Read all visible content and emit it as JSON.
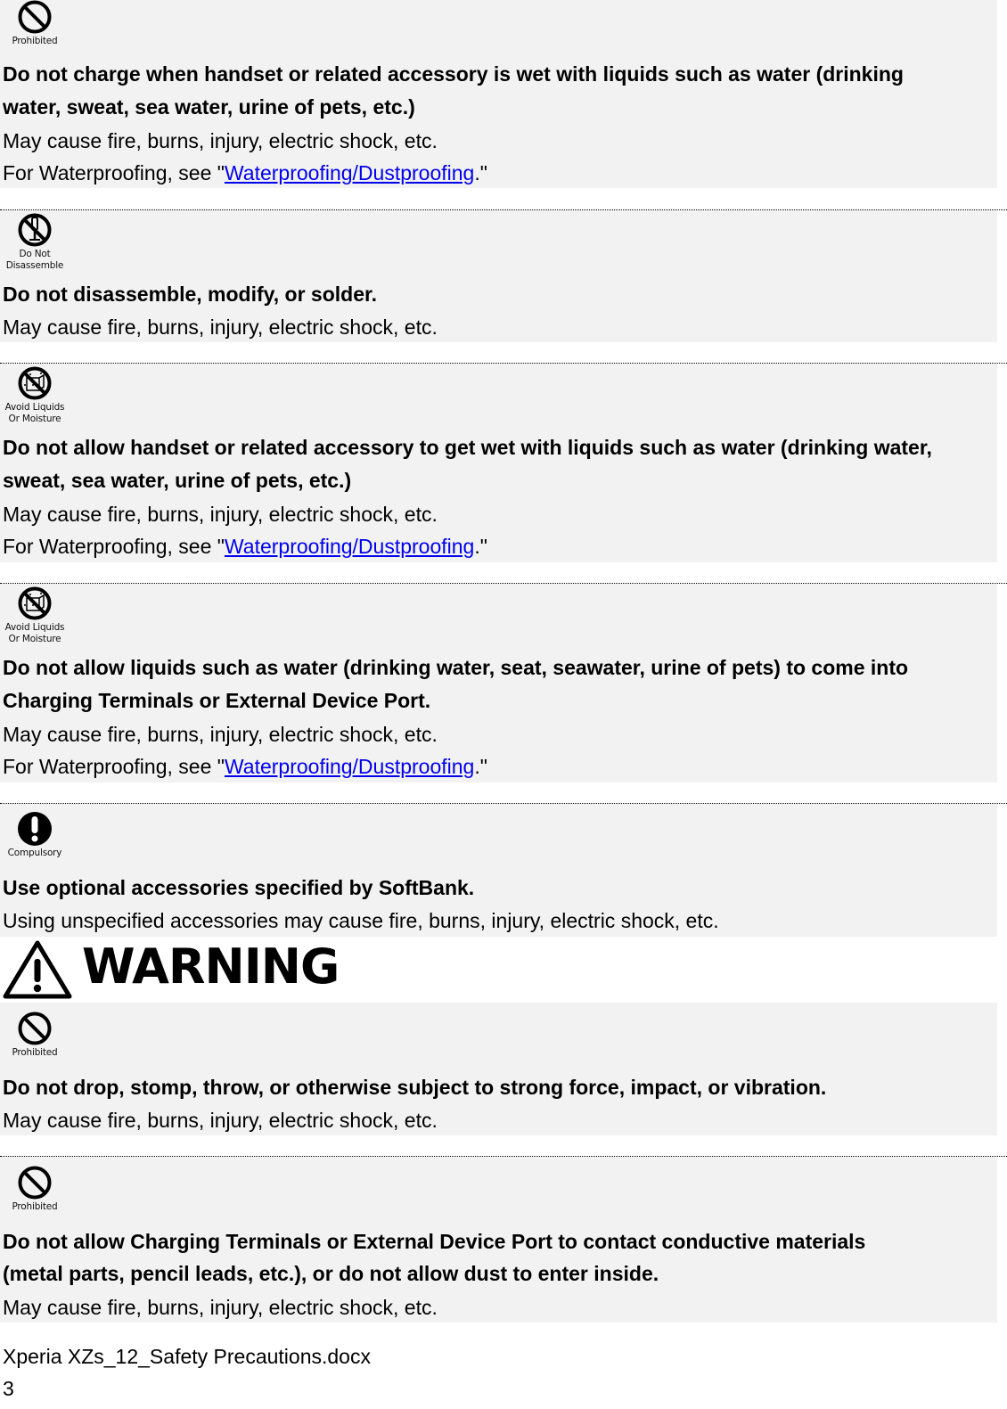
{
  "link_color": "#0000ee",
  "block_bg": "#f2f2f2",
  "sections": [
    {
      "icon": "prohibited-icon",
      "icon_label": "Prohibited",
      "heading_lines": [
        "Do not charge when handset or related accessory is wet with liquids such as water (drinking",
        "water, sweat, sea water, urine of pets, etc.)"
      ],
      "body": "May cause fire, burns, injury, electric shock, etc.",
      "ref_prefix": "For Waterproofing, see \"",
      "ref_link": "Waterproofing/Dustproofing",
      "ref_suffix": ".\""
    },
    {
      "icon": "do-not-disassemble-icon",
      "icon_label_lines": [
        "Do Not",
        "Disassemble"
      ],
      "heading_lines": [
        "Do not disassemble, modify, or solder."
      ],
      "body": "May cause fire, burns, injury, electric shock, etc."
    },
    {
      "icon": "avoid-liquids-icon",
      "icon_label_lines": [
        "Avoid Liquids",
        "Or Moisture"
      ],
      "heading_lines": [
        "Do not allow handset or related accessory to get wet with liquids such as water (drinking water,",
        "sweat, sea water, urine of pets, etc.)"
      ],
      "body": "May cause fire, burns, injury, electric shock, etc.",
      "ref_prefix": "For Waterproofing, see \"",
      "ref_link": "Waterproofing/Dustproofing",
      "ref_suffix": ".\""
    },
    {
      "icon": "avoid-liquids-icon",
      "icon_label_lines": [
        "Avoid Liquids",
        "Or Moisture"
      ],
      "heading_lines": [
        "Do not allow liquids such as water (drinking water, seat, seawater, urine of pets) to come into",
        "Charging Terminals or External Device Port."
      ],
      "body": "May cause fire, burns, injury, electric shock, etc.",
      "ref_prefix": "For Waterproofing, see \"",
      "ref_link": "Waterproofing/Dustproofing",
      "ref_suffix": ".\""
    },
    {
      "icon": "compulsory-icon",
      "icon_label": "Compulsory",
      "heading_lines": [
        "Use optional accessories specified by SoftBank."
      ],
      "body": "Using unspecified accessories may cause fire, burns, injury, electric shock, etc."
    },
    {
      "icon": "prohibited-icon",
      "icon_label": "Prohibited",
      "heading_lines": [
        "Do not drop, stomp, throw, or otherwise subject to strong force, impact, or vibration."
      ],
      "body": "May cause fire, burns, injury, electric shock, etc."
    },
    {
      "icon": "prohibited-icon",
      "icon_label": "Prohibited",
      "heading_lines": [
        "Do not allow Charging Terminals or External Device Port to contact conductive materials",
        "(metal parts, pencil leads, etc.), or do not allow dust to enter inside."
      ],
      "body": "May cause fire, burns, injury, electric shock, etc."
    }
  ],
  "warning_heading": "WARNING",
  "footer": {
    "filename": "Xperia XZs_12_Safety Precautions.docx",
    "page_number": "3"
  }
}
